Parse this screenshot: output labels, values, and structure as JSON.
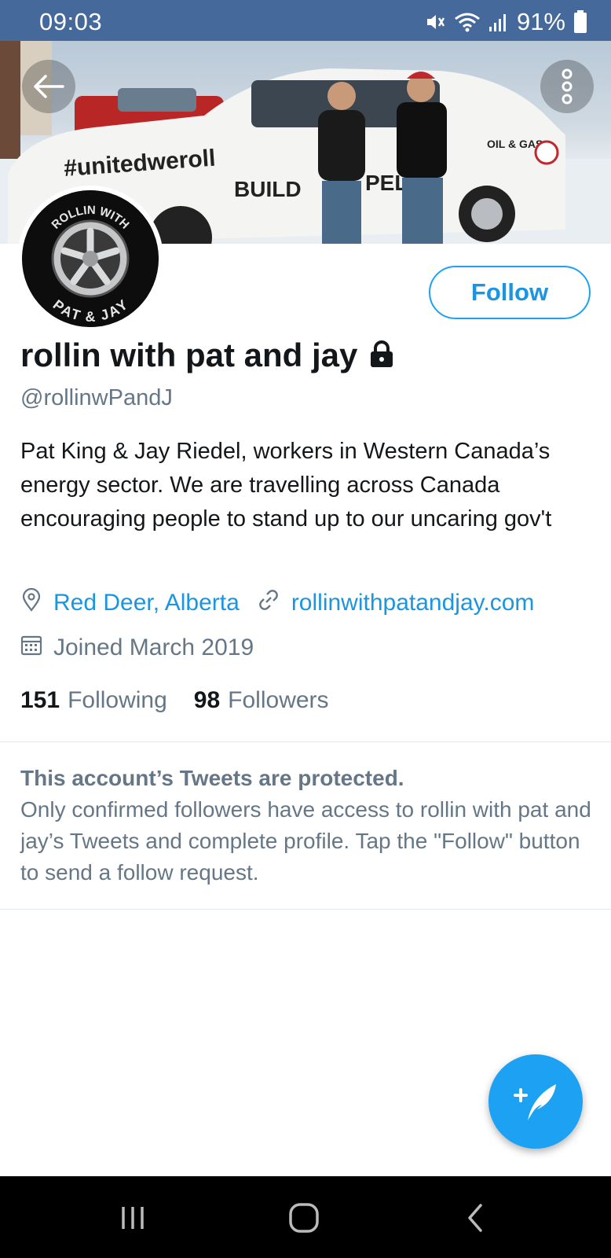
{
  "status_bar": {
    "time": "09:03",
    "battery": "91%",
    "icons": [
      "mute-icon",
      "wifi-icon",
      "signal-icon",
      "battery-icon"
    ]
  },
  "banner": {
    "hashtag": "#unitedweroll",
    "truck_text_1": "BUILD",
    "truck_text_2": "PELI",
    "truck_text_3": "OIL & GAS"
  },
  "avatar": {
    "top_text": "ROLLIN WITH",
    "bottom_text": "PAT & JAY"
  },
  "profile": {
    "follow_label": "Follow",
    "display_name": "rollin with pat and jay",
    "handle": "@rollinwPandJ",
    "bio": "Pat King & Jay Riedel, workers in Western Canada’s energy sector. We are travelling across Canada encouraging people to stand up to our uncaring gov't",
    "location": "Red Deer, Alberta",
    "website": "rollinwithpatandjay.com",
    "joined": "Joined March 2019",
    "following_count": "151",
    "following_label": "Following",
    "followers_count": "98",
    "followers_label": "Followers"
  },
  "protected_notice": {
    "title": "This account’s Tweets are protected.",
    "body": "Only confirmed followers have access to rollin with pat and jay’s Tweets and complete profile. Tap the \"Follow\" button to send a follow request."
  },
  "colors": {
    "status_bar": "#44699a",
    "accent": "#1da1f2",
    "link": "#1b95e0",
    "secondary_text": "#657786",
    "divider": "#e1e8ed"
  }
}
